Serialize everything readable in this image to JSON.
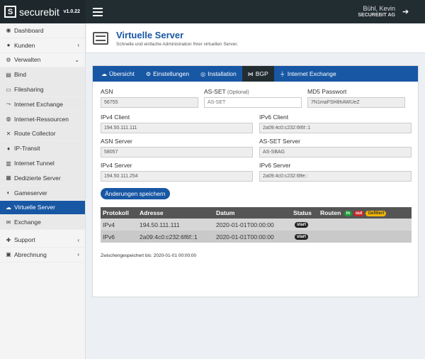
{
  "app": {
    "brand": "securebit",
    "logo_letter": "S",
    "version": "v1.0.22"
  },
  "user": {
    "name": "Bühl, Kevin",
    "company": "SECUREBIT AG"
  },
  "sidebar": {
    "items": [
      {
        "icon": "dashboard-icon",
        "glyph": "◉",
        "label": "Dashboard",
        "chevron": ""
      },
      {
        "icon": "users-icon",
        "glyph": "●",
        "label": "Kunden",
        "chevron": "‹"
      },
      {
        "icon": "cogs-icon",
        "glyph": "⚙",
        "label": "Verwalten",
        "chevron": "⌄"
      },
      {
        "icon": "book-icon",
        "glyph": "▤",
        "label": "Bind",
        "chevron": ""
      },
      {
        "icon": "folder-icon",
        "glyph": "▭",
        "label": "Filesharing",
        "chevron": ""
      },
      {
        "icon": "exchange-icon",
        "glyph": "⤳",
        "label": "Internet Exchange",
        "chevron": ""
      },
      {
        "icon": "globe-icon",
        "glyph": "◍",
        "label": "Internet-Ressourcen",
        "chevron": ""
      },
      {
        "icon": "route-icon",
        "glyph": "✕",
        "label": "Route Collector",
        "chevron": ""
      },
      {
        "icon": "pin-icon",
        "glyph": "♦",
        "label": "IP-Transit",
        "chevron": ""
      },
      {
        "icon": "tunnel-icon",
        "glyph": "▥",
        "label": "Internet Tunnel",
        "chevron": ""
      },
      {
        "icon": "server-icon",
        "glyph": "▦",
        "label": "Dedizierte Server",
        "chevron": ""
      },
      {
        "icon": "gamepad-icon",
        "glyph": "◐",
        "label": "Gameserver",
        "chevron": ""
      },
      {
        "icon": "cloud-icon",
        "glyph": "☁",
        "label": "Virtuelle Server",
        "chevron": ""
      },
      {
        "icon": "mail-icon",
        "glyph": "✉",
        "label": "Exchange",
        "chevron": ""
      },
      {
        "icon": "support-icon",
        "glyph": "✚",
        "label": "Support",
        "chevron": "‹"
      },
      {
        "icon": "invoice-icon",
        "glyph": "▣",
        "label": "Abrechnung",
        "chevron": "‹"
      }
    ]
  },
  "page": {
    "title": "Virtuelle Server",
    "subtitle": "Schnelle und einfache Administration Ihrer virtuellen Server."
  },
  "tabs": [
    {
      "icon": "cloud-icon",
      "glyph": "☁",
      "label": "Übersicht"
    },
    {
      "icon": "settings-icon",
      "glyph": "⚙",
      "label": "Einstellungen"
    },
    {
      "icon": "install-icon",
      "glyph": "◎",
      "label": "Installation"
    },
    {
      "icon": "network-icon",
      "glyph": "⋈",
      "label": "BGP"
    },
    {
      "icon": "plug-icon",
      "glyph": "⏚",
      "label": "Internet Exchange"
    }
  ],
  "form": {
    "asn": {
      "label": "ASN",
      "value": "56755"
    },
    "as_set": {
      "label": "AS-SET",
      "optional": "(Optional)",
      "value": "AS-SET"
    },
    "md5": {
      "label": "MD5 Passwort",
      "value": "7N1maFSH8hAWUeZ"
    },
    "ipv4_client": {
      "label": "IPv4 Client",
      "value": "194.50.111.111"
    },
    "ipv6_client": {
      "label": "IPv6 Client",
      "value": "2a09:4c0:c232:6f6f::1"
    },
    "asn_server": {
      "label": "ASN Server",
      "value": "58057"
    },
    "as_set_server": {
      "label": "AS-SET Server",
      "value": "AS-SBAG"
    },
    "ipv4_server": {
      "label": "IPv4 Server",
      "value": "194.50.111.254"
    },
    "ipv6_server": {
      "label": "IPv6 Server",
      "value": "2a09:4c0:c232:6ffe::"
    },
    "save_label": "Änderungen speichern"
  },
  "table": {
    "headers": {
      "protokoll": "Protokoll",
      "adresse": "Adresse",
      "datum": "Datum",
      "status": "Status",
      "routen": "Routen"
    },
    "badges": {
      "in": "in",
      "out": "out",
      "filtered": "Gefiltert"
    },
    "rows": [
      {
        "protokoll": "IPv4",
        "adresse": "194.50.111.111",
        "datum": "2020-01-01T00:00:00",
        "status": "start"
      },
      {
        "protokoll": "IPv6",
        "adresse": "2a09:4c0:c232:6f6f::1",
        "datum": "2020-01-01T00:00:00",
        "status": "start"
      }
    ]
  },
  "saved_info": "Zwischengespeichert bis: 2020-01-01 00:00:00"
}
